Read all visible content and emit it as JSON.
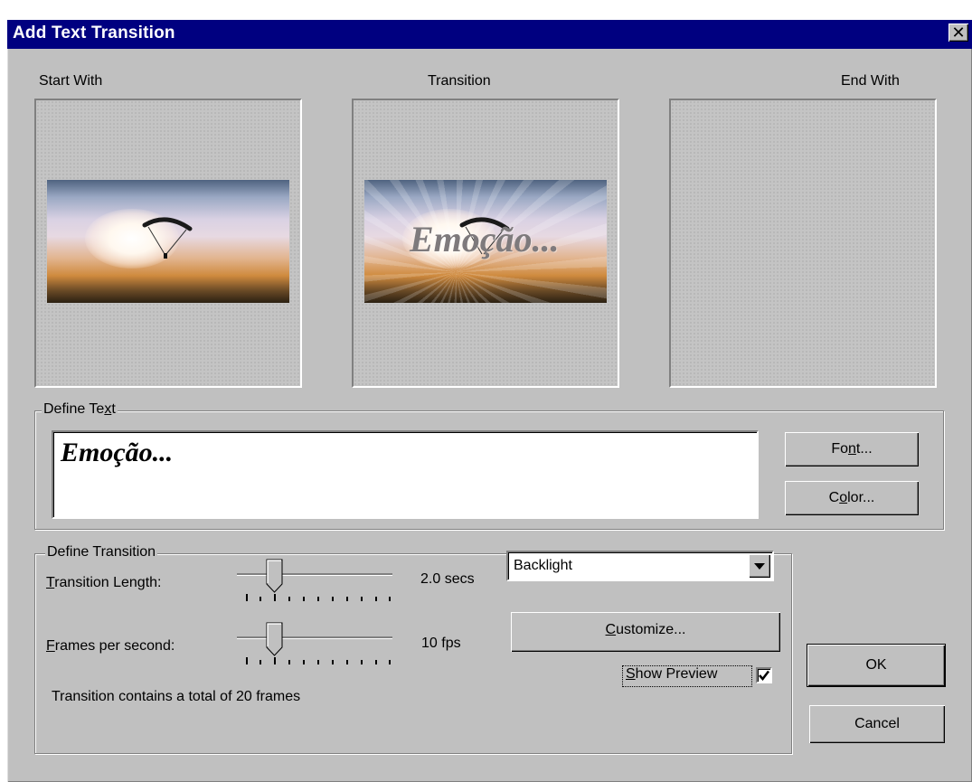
{
  "window": {
    "title": "Add Text Transition",
    "close_label": "✕"
  },
  "preview": {
    "start_label": "Start With",
    "transition_label": "Transition",
    "end_label": "End With",
    "overlay_text": "Emoção..."
  },
  "define_text": {
    "group_label_pre": "Define Te",
    "group_label_ul": "x",
    "group_label_post": "t",
    "text_value": "Emoção...",
    "font_button_pre": "Fo",
    "font_button_ul": "n",
    "font_button_post": "t...",
    "color_button_pre": "C",
    "color_button_ul": "o",
    "color_button_post": "lor..."
  },
  "define_transition": {
    "group_label": "Define Transition",
    "length_label_ul": "T",
    "length_label_post": "ransition Length:",
    "length_value": "2.0 secs",
    "length_slider_fraction": 0.2,
    "fps_label_ul": "F",
    "fps_label_post": "rames per second:",
    "fps_value": "10 fps",
    "fps_slider_fraction": 0.2,
    "effect_selected": "Backlight",
    "customize_ul": "C",
    "customize_post": "ustomize...",
    "show_preview_ul": "S",
    "show_preview_post": "how Preview",
    "show_preview_checked": true,
    "summary": "Transition contains a total of 20 frames"
  },
  "buttons": {
    "ok": "OK",
    "cancel": "Cancel"
  }
}
